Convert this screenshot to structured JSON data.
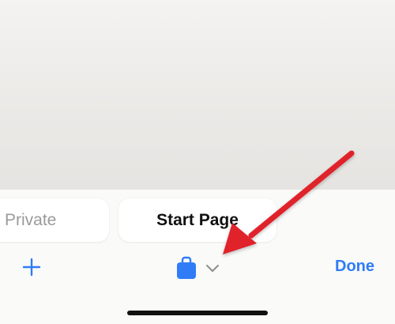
{
  "tabs": {
    "private_label": "Private",
    "start_page_label": "Start Page"
  },
  "toolbar": {
    "new_tab_icon": "plus-icon",
    "tab_groups_icon": "tab-group-icon",
    "chevron_icon": "chevron-down-icon",
    "done_label": "Done"
  },
  "colors": {
    "accent": "#2f7cf6",
    "annotation_arrow": "#e0232a"
  }
}
